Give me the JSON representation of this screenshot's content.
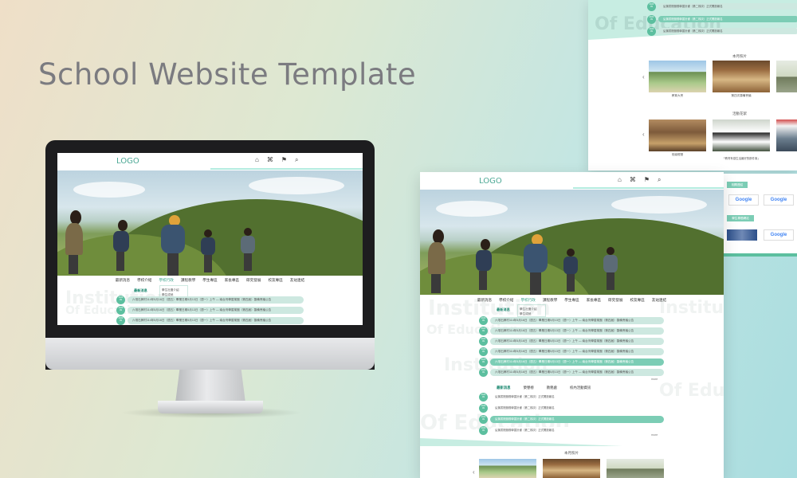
{
  "headline": "School Website Template",
  "site": {
    "logo": "LOGO",
    "icons": [
      "home-icon",
      "school-icon",
      "search-icon"
    ],
    "home_label": "回首頁",
    "nav": [
      "最新消息",
      "學校介紹",
      "學校行政",
      "課程教學",
      "學生專區",
      "家長專區",
      "研究發展",
      "校友專區",
      "友站連結"
    ],
    "dropdown": [
      "學生社團介紹",
      "學生成就"
    ],
    "tabs": [
      "最新消息",
      "榮譽榜",
      "教務處",
      "校內活動資訊"
    ],
    "news": [
      {
        "date_top": "2023",
        "date_bottom": "09",
        "text": "六堆石牌村114年5月16日（週五）畢業日期5月13日（週一）上午 — 南台灣學習樂團（第四屆）籌備會議公告"
      },
      {
        "date_top": "2023",
        "date_bottom": "09",
        "text": "六堆石牌村114年5月16日（週五）畢業日期5月13日（週一）上午 — 南台灣學習樂團（第四屆）籌備會議公告"
      },
      {
        "date_top": "2023",
        "date_bottom": "09",
        "text": "六堆石牌村114年5月16日（週五）畢業日期5月13日（週一）上午 — 南台灣學習樂團（第四屆）籌備會議公告"
      },
      {
        "date_top": "2023",
        "date_bottom": "09",
        "text": "六堆石牌村114年5月16日（週五）畢業日期5月13日（週一）上午 — 南台灣學習樂團（第四屆）籌備會議公告"
      },
      {
        "date_top": "2023",
        "date_bottom": "09",
        "text": "六堆石牌村114年5月16日（週五）畢業日期5月13日（週一）上午 — 南台灣學習樂團（第四屆）籌備會議公告"
      },
      {
        "date_top": "2023",
        "date_bottom": "09",
        "text": "六堆石牌村114年5月16日（週五）畢業日期5月13日（週一）上午 — 南台灣學習樂團（第四屆）籌備會議公告"
      }
    ],
    "news2": [
      {
        "date_top": "2023",
        "date_bottom": "09",
        "text": "弘揚書院服務學習計畫（第二梯次）正式開放報名"
      },
      {
        "date_top": "2023",
        "date_bottom": "09",
        "text": "弘揚書院服務學習計畫（第二梯次）正式開放報名"
      },
      {
        "date_top": "2023",
        "date_bottom": "09",
        "text": "弘揚書院服務學習計畫（第二梯次）正式開放報名"
      },
      {
        "date_top": "2023",
        "date_bottom": "09",
        "text": "弘揚書院服務學習計畫（第二梯次）正式開放報名"
      }
    ],
    "more": "more",
    "photos_title": "本月照片",
    "photo_captions": [
      "教育大會",
      "第四次籌備會議",
      "班級經營"
    ],
    "activity_title": "活動花絮",
    "activity_caption": "「教育有感生活最好的那件事」",
    "links_title": "相關連結",
    "google_label": "Google",
    "student_link": "學生專題網站",
    "watermark": [
      "Institution",
      "Of Education"
    ]
  }
}
